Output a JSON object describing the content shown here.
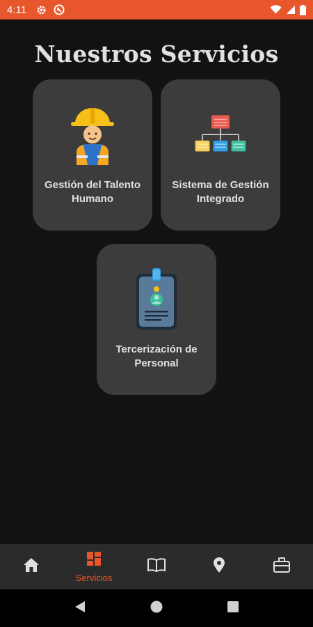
{
  "status_bar": {
    "time": "4:11",
    "background": "#e8572b",
    "left_icons": [
      "gear-icon",
      "app-icon"
    ],
    "right_icons": [
      "wifi-icon",
      "signal-icon",
      "battery-icon"
    ]
  },
  "page": {
    "title": "Nuestros Servicios"
  },
  "services": [
    {
      "label": "Gestión del Talento Humano",
      "icon": "worker-icon"
    },
    {
      "label": "Sistema de Gestión Integrado",
      "icon": "org-chart-icon"
    },
    {
      "label": "Tercerización de Personal",
      "icon": "id-badge-icon"
    }
  ],
  "bottom_nav": {
    "active_color": "#e8572b",
    "items": [
      {
        "icon": "home-icon",
        "label": ""
      },
      {
        "icon": "services-grid-icon",
        "label": "Servicios",
        "active": true
      },
      {
        "icon": "book-icon",
        "label": ""
      },
      {
        "icon": "location-pin-icon",
        "label": ""
      },
      {
        "icon": "briefcase-icon",
        "label": ""
      }
    ]
  },
  "system_nav": {
    "buttons": [
      "back-icon",
      "home-circle-icon",
      "recents-icon"
    ]
  }
}
